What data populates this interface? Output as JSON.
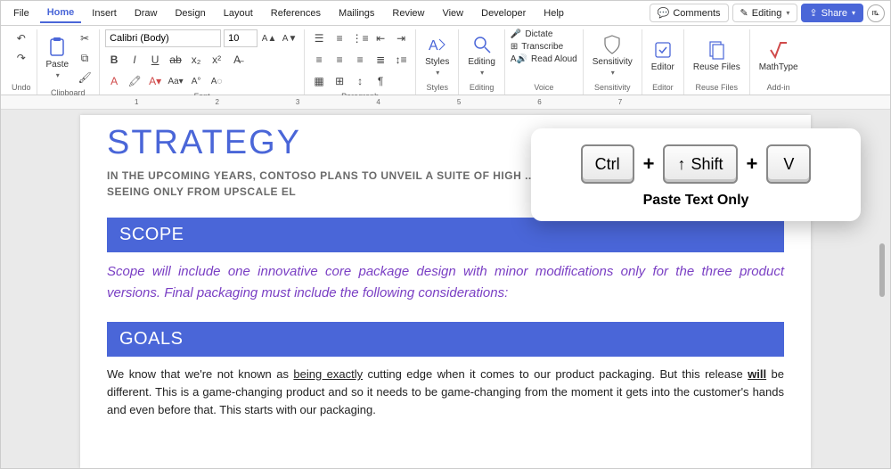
{
  "tabs": [
    "File",
    "Home",
    "Insert",
    "Draw",
    "Design",
    "Layout",
    "References",
    "Mailings",
    "Review",
    "View",
    "Developer",
    "Help"
  ],
  "active_tab": "Home",
  "header_buttons": {
    "comments": "Comments",
    "editing": "Editing",
    "share": "Share"
  },
  "ribbon": {
    "undo_group": "Undo",
    "clipboard_group": "Clipboard",
    "paste": "Paste",
    "font_group": "Font",
    "font_name": "Calibri (Body)",
    "font_size": "10",
    "paragraph_group": "Paragraph",
    "styles_group": "Styles",
    "styles": "Styles",
    "editing_group": "Editing",
    "editing": "Editing",
    "voice_group": "Voice",
    "dictate": "Dictate",
    "transcribe": "Transcribe",
    "read_aloud": "Read Aloud",
    "sensitivity_group": "Sensitivity",
    "sensitivity": "Sensitivity",
    "editor_group": "Editor",
    "editor": "Editor",
    "reuse_group": "Reuse Files",
    "reuse": "Reuse Files",
    "addin_group": "Add-in",
    "mathtype": "MathType"
  },
  "ruler_marks": [
    "1",
    "2",
    "3",
    "4",
    "5",
    "6",
    "7"
  ],
  "document": {
    "title": "STRATEGY",
    "subtitle": "IN THE UPCOMING YEARS, CONTOSO PLANS TO UNVEIL A SUITE OF HIGH ... CONSUMERS MAY BE ACCUSTOMED TO SEEING ONLY FROM UPSCALE EL",
    "scope_heading": "SCOPE",
    "scope_body": "Scope will include one innovative core package design with minor modifications only for the three product versions. Final packaging must include the following considerations:",
    "goals_heading": "GOALS",
    "goals_body_pre": "We know that we're not known as ",
    "goals_u1": "being exactly",
    "goals_body_mid": " cutting edge when it comes to our product packaging. But this release ",
    "goals_u2": "will",
    "goals_body_post": " be different. This is a game-changing product and so it needs to be game-changing from the moment it gets into the customer's hands and even before that. This starts with our packaging."
  },
  "kb_tip": {
    "key1": "Ctrl",
    "key2": "Shift",
    "key3": "V",
    "label": "Paste Text Only"
  }
}
